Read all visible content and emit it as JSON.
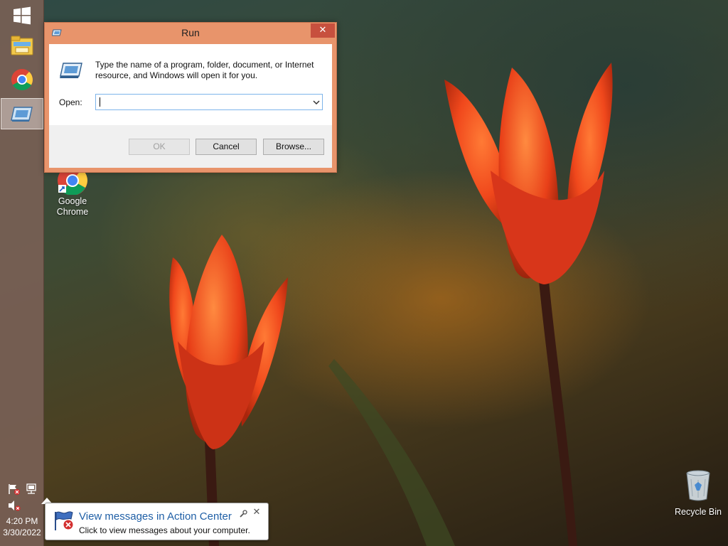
{
  "run_dialog": {
    "title": "Run",
    "close_glyph": "✕",
    "message": "Type the name of a program, folder, document, or Internet resource, and Windows will open it for you.",
    "open_label": "Open:",
    "open_value": "",
    "ok_label": "OK",
    "cancel_label": "Cancel",
    "browse_label": "Browse..."
  },
  "taskbar": {
    "buttons": [
      {
        "name": "start",
        "icon": "windows-logo-icon"
      },
      {
        "name": "file-explorer",
        "icon": "folder-icon"
      },
      {
        "name": "google-chrome",
        "icon": "chrome-icon"
      },
      {
        "name": "run",
        "icon": "run-dialog-icon",
        "active": true
      }
    ],
    "tray": {
      "action_center_icon": "flag-error-icon",
      "network_icon": "network-icon",
      "volume_icon": "speaker-muted-icon"
    },
    "clock": {
      "time": "4:20 PM",
      "date": "3/30/2022"
    }
  },
  "desktop": {
    "icons": [
      {
        "label": "Google Chrome",
        "line1": "Google",
        "line2": "Chrome",
        "icon": "chrome-icon"
      },
      {
        "label": "Recycle Bin",
        "icon": "recycle-bin-icon"
      }
    ]
  },
  "toast": {
    "title": "View messages in Action Center",
    "subtitle": "Click to view messages about your computer.",
    "close_glyph": "✕"
  },
  "colors": {
    "run_frame": "#e8946b",
    "run_close": "#c7503e",
    "taskbar": "#78605a",
    "toast_title": "#1f5fa6"
  }
}
